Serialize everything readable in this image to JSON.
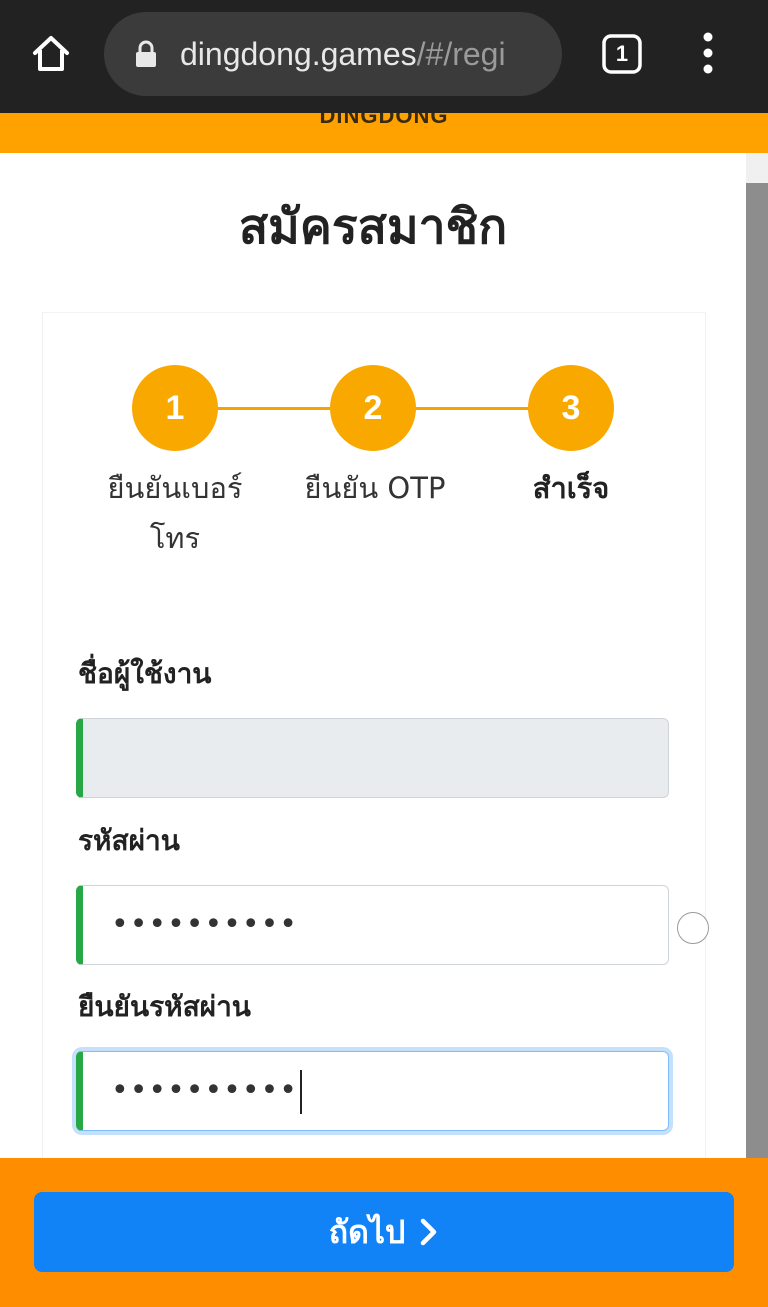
{
  "browser": {
    "url_host": "dingdong.games",
    "url_path": "/#/regi",
    "tab_count": "1"
  },
  "site": {
    "logo_text": "DINGDONG"
  },
  "page": {
    "title": "สมัครสมาชิก"
  },
  "steps": [
    {
      "number": "1",
      "label_line1": "ยืนยันเบอร์",
      "label_line2": "โทร",
      "active": false
    },
    {
      "number": "2",
      "label_line1": "ยืนยัน OTP",
      "active": false
    },
    {
      "number": "3",
      "label_line1": "สำเร็จ",
      "active": true
    }
  ],
  "form": {
    "username_label": "ชื่อผู้ใช้งาน",
    "username_value": "",
    "password_label": "รหัสผ่าน",
    "password_value": "••••••••••",
    "confirm_label": "ยืนยันรหัสผ่าน",
    "confirm_value": "••••••••••"
  },
  "actions": {
    "next_label": "ถัดไป"
  },
  "colors": {
    "accent": "#ffa200",
    "step": "#f9a800",
    "primary_button": "#1282f7",
    "valid_border": "#28a745"
  },
  "icons": {
    "home": "home-icon",
    "lock": "lock-icon",
    "tabs": "tabs-icon",
    "menu": "more-vertical-icon",
    "chevron": "chevron-right-icon"
  }
}
